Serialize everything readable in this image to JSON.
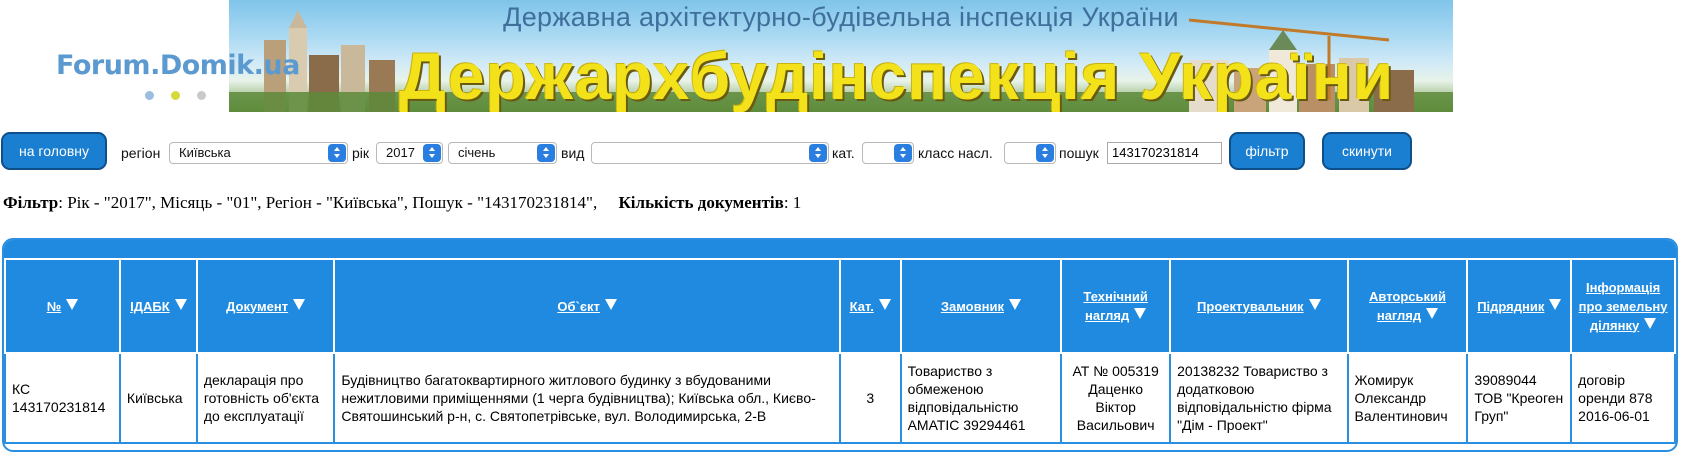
{
  "banner": {
    "top_line": "Державна архітектурно-будівельна інспекція України",
    "main_line": "Держархбудінспекція України"
  },
  "forum_logo": "Forum.Domik.ua",
  "toolbar": {
    "home_label": "на головну",
    "region_label": "регіон",
    "region_value": "Київська",
    "year_label": "рік",
    "year_value": "2017",
    "month_value": "січень",
    "type_label": "вид",
    "type_value": "",
    "category_label": "кат.",
    "category_value": "",
    "class_label": "класс насл.",
    "class_value": "",
    "search_label": "пошук",
    "search_value": "143170231814",
    "filter_label": "фільтр",
    "reset_label": "скинути"
  },
  "filter_summary": {
    "filter_label": "Фільтр",
    "filter_text": ": Рік - \"2017\", Місяць - \"01\", Регіон - \"Київська\", Пошук - \"143170231814\",",
    "count_label": "Кількість документів",
    "count_value": ": 1"
  },
  "table": {
    "headers": [
      "№",
      "ІДАБК",
      "Документ",
      "Об`єкт",
      "Кат.",
      "Замовник",
      "Технічний нагляд",
      "Проектувальник",
      "Авторський нагляд",
      "Підрядник",
      "Інформація про земельну ділянку"
    ],
    "rows": [
      [
        "КС 143170231814",
        "Київська",
        "декларація про готовність об'єкта до експлуатації",
        "Будівництво багатоквартирного житлового будинку з вбудованими нежитловими приміщеннями (1 черга будівництва); Київська обл., Києво-Святошинський р-н, с. Святопетрівське, вул. Володимирська, 2-В",
        "3",
        "Товариство з обмеженою відповідальністю АМАТІС 39294461",
        "АТ № 005319 Даценко Віктор Васильович",
        "20138232 Товариство з додатковою відповідальністю фірма \"Дім - Проект\"",
        "Жомирук Олександр Валентинович",
        "39089044 ТОВ \"Креоген Груп\"",
        "договір оренди 878 2016-06-01"
      ]
    ]
  },
  "colors": {
    "accent": "#1f8ae0",
    "button": "#1a7fd1",
    "banner_text": "#f3e21a"
  }
}
